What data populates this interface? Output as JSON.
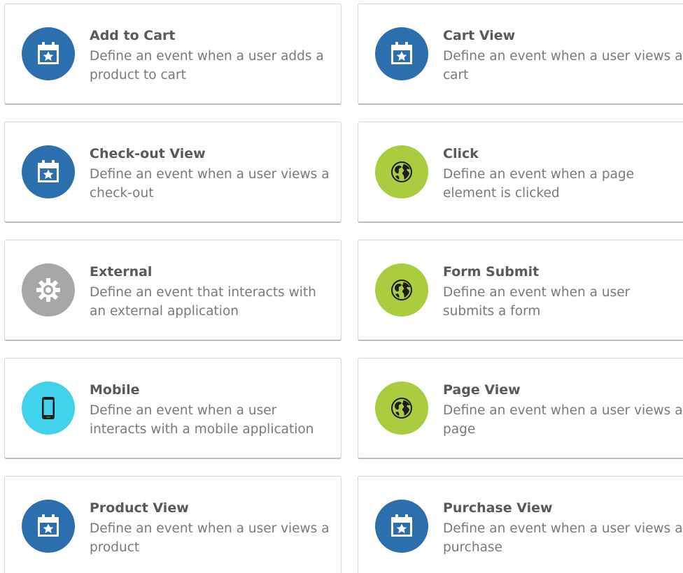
{
  "colors": {
    "blue": "#2b6fae",
    "green": "#a9cd3f",
    "gray": "#a7a7a7",
    "cyan": "#41d3ec"
  },
  "cards": [
    {
      "title": "Add to Cart",
      "description": "Define an event when a user adds a product to cart",
      "icon": "calendar-star-icon",
      "icon_color": "#2b6fae"
    },
    {
      "title": "Cart View",
      "description": "Define an event when a user views a cart",
      "icon": "calendar-star-icon",
      "icon_color": "#2b6fae"
    },
    {
      "title": "Check-out View",
      "description": "Define an event when a user views a check-out",
      "icon": "calendar-star-icon",
      "icon_color": "#2b6fae"
    },
    {
      "title": "Click",
      "description": "Define an event when a page element is clicked",
      "icon": "globe-icon",
      "icon_color": "#a9cd3f"
    },
    {
      "title": "External",
      "description": "Define an event that interacts with an external application",
      "icon": "gear-icon",
      "icon_color": "#a7a7a7"
    },
    {
      "title": "Form Submit",
      "description": "Define an event when a user submits a form",
      "icon": "globe-icon",
      "icon_color": "#a9cd3f"
    },
    {
      "title": "Mobile",
      "description": "Define an event when a user interacts with a mobile application",
      "icon": "mobile-phone-icon",
      "icon_color": "#41d3ec"
    },
    {
      "title": "Page View",
      "description": "Define an event when a user views a page",
      "icon": "globe-icon",
      "icon_color": "#a9cd3f"
    },
    {
      "title": "Product View",
      "description": "Define an event when a user views a product",
      "icon": "calendar-star-icon",
      "icon_color": "#2b6fae"
    },
    {
      "title": "Purchase View",
      "description": "Define an event when a user views a purchase",
      "icon": "calendar-star-icon",
      "icon_color": "#2b6fae"
    }
  ]
}
